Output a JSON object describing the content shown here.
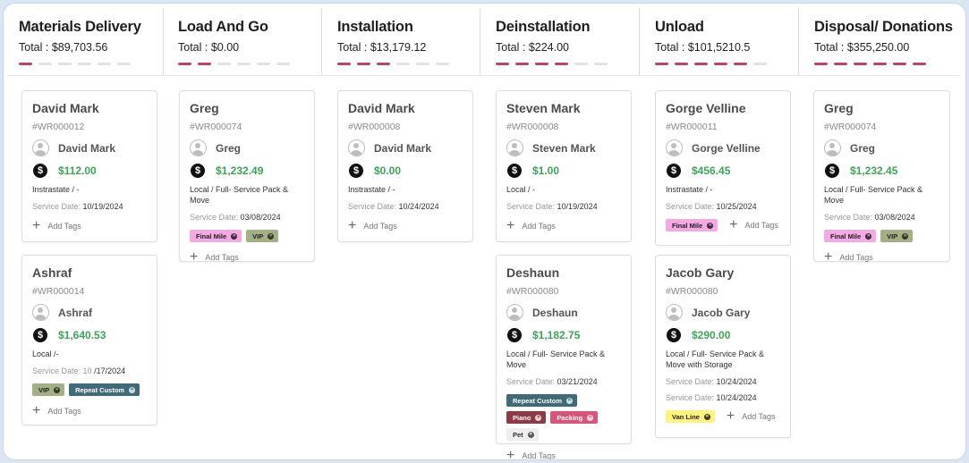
{
  "colors": {
    "accent": "#c2406a",
    "amount": "#3aa655",
    "tag_final_mile": "#f4a9e3",
    "tag_vip": "#a3b083",
    "tag_repeat_custom": "#3f6a78",
    "tag_piano": "#8b3a46",
    "tag_packing": "#d9547a",
    "tag_pet": "#eeeeee",
    "tag_van_line": "#fff27d"
  },
  "labels": {
    "service_date": "Service Date:",
    "add_tags": "Add Tags"
  },
  "columns": [
    {
      "title": "Materials Delivery",
      "total": "Total : $89,703.56",
      "progress": 1,
      "cards": [
        {
          "name": "David Mark",
          "id": "#WR000012",
          "assignee": "David Mark",
          "amount": "$112.00",
          "move": "Instrastate / -",
          "date_label": "Service Date:",
          "date": "10/19/2024",
          "tags": []
        },
        {
          "name": "Ashraf",
          "id": "#WR000014",
          "assignee": "Ashraf",
          "amount": "$1,640.53",
          "move": "Local /-",
          "date_label": "Service Date: 10",
          "date": "/17/2024",
          "tags": [
            {
              "label": "VIP",
              "bg": "#a3b083",
              "fg": "#1f1f1f",
              "xbg": "#2f3a2a",
              "xfg": "#a3b083"
            },
            {
              "label": "Repeat Custom",
              "bg": "#3f6a78",
              "fg": "#ffffff",
              "xbg": "#cfe0e6",
              "xfg": "#3f6a78"
            }
          ]
        }
      ]
    },
    {
      "title": "Load And Go",
      "total": "Total : $0.00",
      "progress": 2,
      "cards": [
        {
          "name": "Greg",
          "id": "#WR000074",
          "assignee": "Greg",
          "amount": "$1,232.49",
          "move": "Local / Full- Service Pack & Move",
          "date_label": "Service Date:",
          "date": "03/08/2024",
          "tags": [
            {
              "label": "Final Mile",
              "bg": "#f4a9e3",
              "fg": "#1f1f1f",
              "xbg": "#3a2a36",
              "xfg": "#f4a9e3"
            },
            {
              "label": "VIP",
              "bg": "#a3b083",
              "fg": "#1f1f1f",
              "xbg": "#2f3a2a",
              "xfg": "#a3b083"
            }
          ]
        }
      ]
    },
    {
      "title": "Installation",
      "total": "Total : $13,179.12",
      "progress": 3,
      "cards": [
        {
          "name": "David Mark",
          "id": "#WR000008",
          "assignee": "David Mark",
          "amount": "$0.00",
          "move": "Instrastate / -",
          "date_label": "Service Date:",
          "date": "10/24/2024",
          "tags": []
        }
      ]
    },
    {
      "title": "Deinstallation",
      "total": "Total : $224.00",
      "progress": 4,
      "cards": [
        {
          "name": "Steven Mark",
          "id": "#WR000008",
          "assignee": "Steven Mark",
          "amount": "$1.00",
          "move": "Local / -",
          "date_label": "Service Date:",
          "date": "10/19/2024",
          "tags": []
        },
        {
          "name": "Deshaun",
          "id": "#WR000080",
          "assignee": "Deshaun",
          "amount": "$1,182.75",
          "move": "Local / Full- Service Pack & Move",
          "date_label": "Service Date:",
          "date": "03/21/2024",
          "tags": [
            {
              "label": "Repeat Custom",
              "bg": "#3f6a78",
              "fg": "#ffffff",
              "xbg": "#cfe0e6",
              "xfg": "#3f6a78"
            },
            {
              "label": "Piano",
              "bg": "#8b3a46",
              "fg": "#ffffff",
              "xbg": "#f1d5d9",
              "xfg": "#8b3a46"
            },
            {
              "label": "Packing",
              "bg": "#d9547a",
              "fg": "#ffffff",
              "xbg": "#fbdbe4",
              "xfg": "#d9547a"
            },
            {
              "label": "Pet",
              "bg": "#eeeeee",
              "fg": "#333333",
              "xbg": "#555555",
              "xfg": "#eeeeee"
            }
          ]
        }
      ]
    },
    {
      "title": "Unload",
      "total": "Total : $101,5210.5",
      "progress": 5,
      "cards": [
        {
          "name": "Gorge Velline",
          "id": "#WR000011",
          "assignee": "Gorge Velline",
          "amount": "$456.45",
          "move": "Instrastate / -",
          "date_label": "Service Date:",
          "date": "10/25/2024",
          "tags": [
            {
              "label": "Final Mile",
              "bg": "#f4a9e3",
              "fg": "#1f1f1f",
              "xbg": "#3a2a36",
              "xfg": "#f4a9e3"
            }
          ]
        },
        {
          "name": "Jacob Gary",
          "id": "#WR000080",
          "assignee": "Jacob Gary",
          "amount": "$290.00",
          "move": "Local / Full- Service Pack & Move with Storage",
          "date_label": "Service Date:",
          "date": "10/24/2024",
          "date2_label": "Service Date:",
          "date2": "10/24/2024",
          "tags": [
            {
              "label": "Van Line",
              "bg": "#fff27d",
              "fg": "#1f1f1f",
              "xbg": "#3a3820",
              "xfg": "#fff27d"
            }
          ]
        }
      ]
    },
    {
      "title": "Disposal/ Donations",
      "total": "Total : $355,250.00",
      "progress": 6,
      "cards": [
        {
          "name": "Greg",
          "id": "#WR000074",
          "assignee": "Greg",
          "amount": "$1,232.45",
          "move": "Local / Full- Service Pack & Move",
          "date_label": "Service Date:",
          "date": "03/08/2024",
          "tags": [
            {
              "label": "Final Mile",
              "bg": "#f4a9e3",
              "fg": "#1f1f1f",
              "xbg": "#3a2a36",
              "xfg": "#f4a9e3"
            },
            {
              "label": "VIP",
              "bg": "#a3b083",
              "fg": "#1f1f1f",
              "xbg": "#2f3a2a",
              "xfg": "#a3b083"
            }
          ]
        }
      ]
    }
  ]
}
